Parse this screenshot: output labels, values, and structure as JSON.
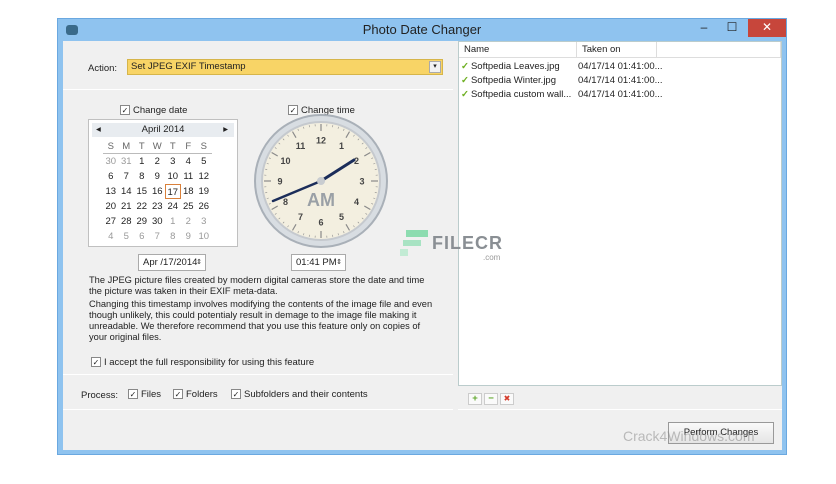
{
  "window": {
    "title": "Photo Date Changer",
    "minimize": "–",
    "maximize": "☐",
    "close": "✕"
  },
  "action": {
    "label": "Action:",
    "value": "Set JPEG EXIF Timestamp"
  },
  "date": {
    "checkbox": "Change date",
    "month": "April 2014",
    "prev": "◂",
    "next": "▸",
    "day_names": [
      "S",
      "M",
      "T",
      "W",
      "T",
      "F",
      "S"
    ],
    "days": [
      "30",
      "31",
      "1",
      "2",
      "3",
      "4",
      "5",
      "6",
      "7",
      "8",
      "9",
      "10",
      "11",
      "12",
      "13",
      "14",
      "15",
      "16",
      "17",
      "18",
      "19",
      "20",
      "21",
      "22",
      "23",
      "24",
      "25",
      "26",
      "27",
      "28",
      "29",
      "30",
      "1",
      "2",
      "3",
      "4",
      "5",
      "6",
      "7",
      "8",
      "9",
      "10"
    ],
    "value": "Apr /17/2014"
  },
  "time": {
    "checkbox": "Change time",
    "value": "01:41 PM",
    "ampm": "AM",
    "numbers": [
      "12",
      "1",
      "2",
      "3",
      "4",
      "5",
      "6",
      "7",
      "8",
      "9",
      "10",
      "11"
    ]
  },
  "info1": "The JPEG picture files created by modern digital cameras store the date and time the picture was taken in their EXIF meta-data.",
  "info2": "Changing this timestamp involves modifying the contents of the image file and even though unlikely, this could potentialy result in demage to the image file making it unreadable. We therefore recommend that you use this feature only on copies of your original files.",
  "accept": "I accept the full responsibility for using this feature",
  "process": {
    "label": "Process:",
    "files": "Files",
    "folders": "Folders",
    "subfolders": "Subfolders and their contents"
  },
  "list": {
    "headers": [
      "Name",
      "Taken on"
    ],
    "rows": [
      {
        "name": "Softpedia Leaves.jpg",
        "taken": "04/17/14 01:41:00..."
      },
      {
        "name": "Softpedia Winter.jpg",
        "taken": "04/17/14 01:41:00..."
      },
      {
        "name": "Softpedia custom wall...",
        "taken": "04/17/14 01:41:00..."
      }
    ]
  },
  "toolbar": {
    "add": "+",
    "remove": "−",
    "delete": "✖"
  },
  "perform": "Perform Changes",
  "watermarks": {
    "filecr": "FILECR",
    "filecr_sub": ".com",
    "crack": "Crack4Windows.com"
  },
  "check": "✓"
}
